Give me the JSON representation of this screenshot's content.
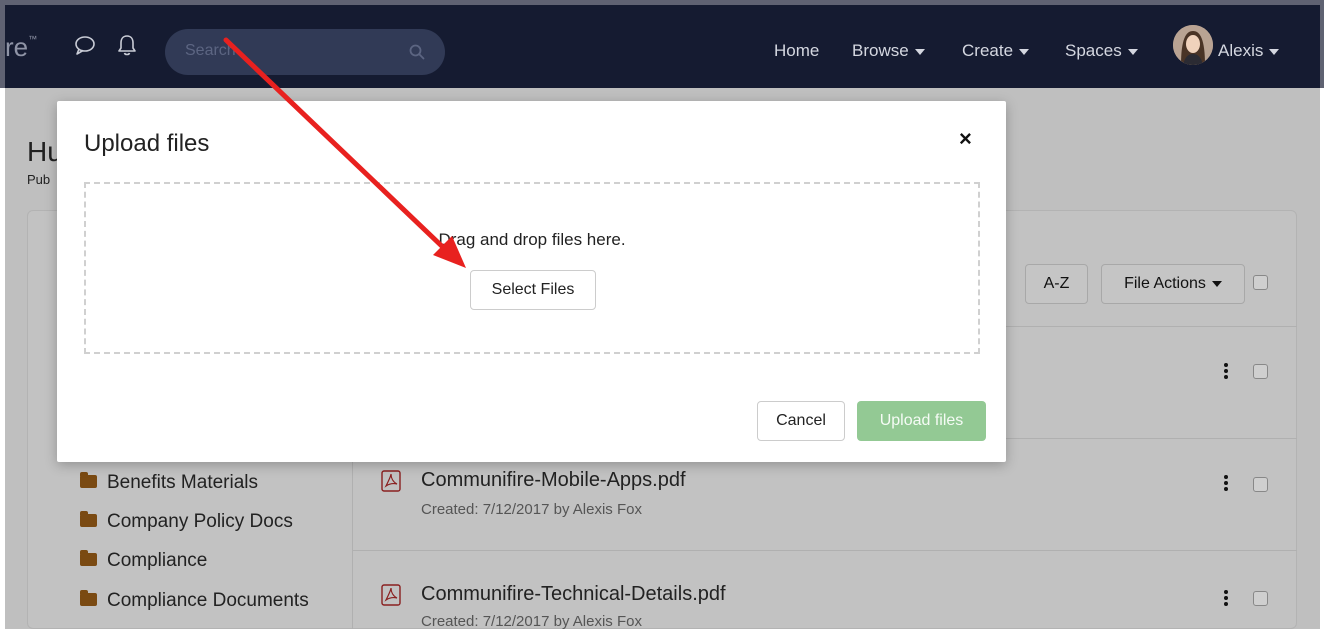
{
  "navbar": {
    "brand_fragment": "re",
    "brand_mark": "™",
    "search_placeholder": "Search",
    "links": {
      "home": "Home",
      "browse": "Browse",
      "create": "Create",
      "spaces": "Spaces",
      "user": "Alexis"
    },
    "icons": [
      "chat-bubble-icon",
      "bell-icon",
      "search-icon"
    ]
  },
  "page": {
    "title_fragment": "Hu",
    "subtitle_fragment": "Pub",
    "sort_label": "A-Z",
    "file_actions_label": "File Actions",
    "folders": [
      {
        "label": "Benefits Materials"
      },
      {
        "label": "Company Policy Docs"
      },
      {
        "label": "Compliance"
      },
      {
        "label": "Compliance Documents"
      }
    ],
    "files": [
      {
        "name": "Communifire-Mobile-Apps.pdf",
        "meta": "Created: 7/12/2017 by Alexis Fox"
      },
      {
        "name": "Communifire-Technical-Details.pdf",
        "meta": "Created: 7/12/2017 by Alexis Fox"
      }
    ]
  },
  "modal": {
    "title": "Upload files",
    "close_glyph": "×",
    "dropzone_text": "Drag and drop files here.",
    "select_files": "Select Files",
    "cancel": "Cancel",
    "upload": "Upload files"
  },
  "colors": {
    "navbar": "#151b31",
    "upload_button": "#93c994",
    "annotation_arrow": "#e8211f",
    "folder": "#7a4a12"
  }
}
